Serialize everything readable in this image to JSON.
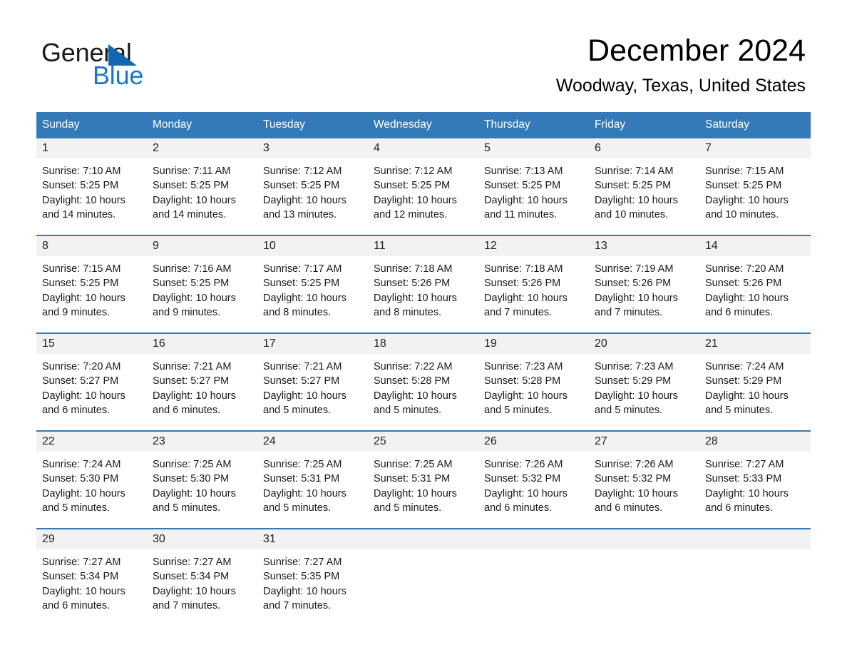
{
  "brand": {
    "name_part1": "General",
    "name_part2": "Blue",
    "triangle_icon": "triangle-icon",
    "accent_color": "#1878c8",
    "triangle_color": "#1267b0"
  },
  "header": {
    "month_title": "December 2024",
    "location": "Woodway, Texas, United States"
  },
  "theme": {
    "header_row_bg": "#3479b8",
    "header_row_text": "#ffffff",
    "daynum_band_bg": "#f2f2f2",
    "week_separator": "#3479b8",
    "body_text": "#1a1a1a",
    "page_bg": "#ffffff"
  },
  "calendar": {
    "weekday_headers": [
      "Sunday",
      "Monday",
      "Tuesday",
      "Wednesday",
      "Thursday",
      "Friday",
      "Saturday"
    ],
    "weeks": [
      [
        {
          "day": "1",
          "sunrise": "Sunrise: 7:10 AM",
          "sunset": "Sunset: 5:25 PM",
          "daylight_line1": "Daylight: 10 hours",
          "daylight_line2": "and 14 minutes."
        },
        {
          "day": "2",
          "sunrise": "Sunrise: 7:11 AM",
          "sunset": "Sunset: 5:25 PM",
          "daylight_line1": "Daylight: 10 hours",
          "daylight_line2": "and 14 minutes."
        },
        {
          "day": "3",
          "sunrise": "Sunrise: 7:12 AM",
          "sunset": "Sunset: 5:25 PM",
          "daylight_line1": "Daylight: 10 hours",
          "daylight_line2": "and 13 minutes."
        },
        {
          "day": "4",
          "sunrise": "Sunrise: 7:12 AM",
          "sunset": "Sunset: 5:25 PM",
          "daylight_line1": "Daylight: 10 hours",
          "daylight_line2": "and 12 minutes."
        },
        {
          "day": "5",
          "sunrise": "Sunrise: 7:13 AM",
          "sunset": "Sunset: 5:25 PM",
          "daylight_line1": "Daylight: 10 hours",
          "daylight_line2": "and 11 minutes."
        },
        {
          "day": "6",
          "sunrise": "Sunrise: 7:14 AM",
          "sunset": "Sunset: 5:25 PM",
          "daylight_line1": "Daylight: 10 hours",
          "daylight_line2": "and 10 minutes."
        },
        {
          "day": "7",
          "sunrise": "Sunrise: 7:15 AM",
          "sunset": "Sunset: 5:25 PM",
          "daylight_line1": "Daylight: 10 hours",
          "daylight_line2": "and 10 minutes."
        }
      ],
      [
        {
          "day": "8",
          "sunrise": "Sunrise: 7:15 AM",
          "sunset": "Sunset: 5:25 PM",
          "daylight_line1": "Daylight: 10 hours",
          "daylight_line2": "and 9 minutes."
        },
        {
          "day": "9",
          "sunrise": "Sunrise: 7:16 AM",
          "sunset": "Sunset: 5:25 PM",
          "daylight_line1": "Daylight: 10 hours",
          "daylight_line2": "and 9 minutes."
        },
        {
          "day": "10",
          "sunrise": "Sunrise: 7:17 AM",
          "sunset": "Sunset: 5:25 PM",
          "daylight_line1": "Daylight: 10 hours",
          "daylight_line2": "and 8 minutes."
        },
        {
          "day": "11",
          "sunrise": "Sunrise: 7:18 AM",
          "sunset": "Sunset: 5:26 PM",
          "daylight_line1": "Daylight: 10 hours",
          "daylight_line2": "and 8 minutes."
        },
        {
          "day": "12",
          "sunrise": "Sunrise: 7:18 AM",
          "sunset": "Sunset: 5:26 PM",
          "daylight_line1": "Daylight: 10 hours",
          "daylight_line2": "and 7 minutes."
        },
        {
          "day": "13",
          "sunrise": "Sunrise: 7:19 AM",
          "sunset": "Sunset: 5:26 PM",
          "daylight_line1": "Daylight: 10 hours",
          "daylight_line2": "and 7 minutes."
        },
        {
          "day": "14",
          "sunrise": "Sunrise: 7:20 AM",
          "sunset": "Sunset: 5:26 PM",
          "daylight_line1": "Daylight: 10 hours",
          "daylight_line2": "and 6 minutes."
        }
      ],
      [
        {
          "day": "15",
          "sunrise": "Sunrise: 7:20 AM",
          "sunset": "Sunset: 5:27 PM",
          "daylight_line1": "Daylight: 10 hours",
          "daylight_line2": "and 6 minutes."
        },
        {
          "day": "16",
          "sunrise": "Sunrise: 7:21 AM",
          "sunset": "Sunset: 5:27 PM",
          "daylight_line1": "Daylight: 10 hours",
          "daylight_line2": "and 6 minutes."
        },
        {
          "day": "17",
          "sunrise": "Sunrise: 7:21 AM",
          "sunset": "Sunset: 5:27 PM",
          "daylight_line1": "Daylight: 10 hours",
          "daylight_line2": "and 5 minutes."
        },
        {
          "day": "18",
          "sunrise": "Sunrise: 7:22 AM",
          "sunset": "Sunset: 5:28 PM",
          "daylight_line1": "Daylight: 10 hours",
          "daylight_line2": "and 5 minutes."
        },
        {
          "day": "19",
          "sunrise": "Sunrise: 7:23 AM",
          "sunset": "Sunset: 5:28 PM",
          "daylight_line1": "Daylight: 10 hours",
          "daylight_line2": "and 5 minutes."
        },
        {
          "day": "20",
          "sunrise": "Sunrise: 7:23 AM",
          "sunset": "Sunset: 5:29 PM",
          "daylight_line1": "Daylight: 10 hours",
          "daylight_line2": "and 5 minutes."
        },
        {
          "day": "21",
          "sunrise": "Sunrise: 7:24 AM",
          "sunset": "Sunset: 5:29 PM",
          "daylight_line1": "Daylight: 10 hours",
          "daylight_line2": "and 5 minutes."
        }
      ],
      [
        {
          "day": "22",
          "sunrise": "Sunrise: 7:24 AM",
          "sunset": "Sunset: 5:30 PM",
          "daylight_line1": "Daylight: 10 hours",
          "daylight_line2": "and 5 minutes."
        },
        {
          "day": "23",
          "sunrise": "Sunrise: 7:25 AM",
          "sunset": "Sunset: 5:30 PM",
          "daylight_line1": "Daylight: 10 hours",
          "daylight_line2": "and 5 minutes."
        },
        {
          "day": "24",
          "sunrise": "Sunrise: 7:25 AM",
          "sunset": "Sunset: 5:31 PM",
          "daylight_line1": "Daylight: 10 hours",
          "daylight_line2": "and 5 minutes."
        },
        {
          "day": "25",
          "sunrise": "Sunrise: 7:25 AM",
          "sunset": "Sunset: 5:31 PM",
          "daylight_line1": "Daylight: 10 hours",
          "daylight_line2": "and 5 minutes."
        },
        {
          "day": "26",
          "sunrise": "Sunrise: 7:26 AM",
          "sunset": "Sunset: 5:32 PM",
          "daylight_line1": "Daylight: 10 hours",
          "daylight_line2": "and 6 minutes."
        },
        {
          "day": "27",
          "sunrise": "Sunrise: 7:26 AM",
          "sunset": "Sunset: 5:32 PM",
          "daylight_line1": "Daylight: 10 hours",
          "daylight_line2": "and 6 minutes."
        },
        {
          "day": "28",
          "sunrise": "Sunrise: 7:27 AM",
          "sunset": "Sunset: 5:33 PM",
          "daylight_line1": "Daylight: 10 hours",
          "daylight_line2": "and 6 minutes."
        }
      ],
      [
        {
          "day": "29",
          "sunrise": "Sunrise: 7:27 AM",
          "sunset": "Sunset: 5:34 PM",
          "daylight_line1": "Daylight: 10 hours",
          "daylight_line2": "and 6 minutes."
        },
        {
          "day": "30",
          "sunrise": "Sunrise: 7:27 AM",
          "sunset": "Sunset: 5:34 PM",
          "daylight_line1": "Daylight: 10 hours",
          "daylight_line2": "and 7 minutes."
        },
        {
          "day": "31",
          "sunrise": "Sunrise: 7:27 AM",
          "sunset": "Sunset: 5:35 PM",
          "daylight_line1": "Daylight: 10 hours",
          "daylight_line2": "and 7 minutes."
        },
        {
          "day": "",
          "sunrise": "",
          "sunset": "",
          "daylight_line1": "",
          "daylight_line2": ""
        },
        {
          "day": "",
          "sunrise": "",
          "sunset": "",
          "daylight_line1": "",
          "daylight_line2": ""
        },
        {
          "day": "",
          "sunrise": "",
          "sunset": "",
          "daylight_line1": "",
          "daylight_line2": ""
        },
        {
          "day": "",
          "sunrise": "",
          "sunset": "",
          "daylight_line1": "",
          "daylight_line2": ""
        }
      ]
    ]
  }
}
